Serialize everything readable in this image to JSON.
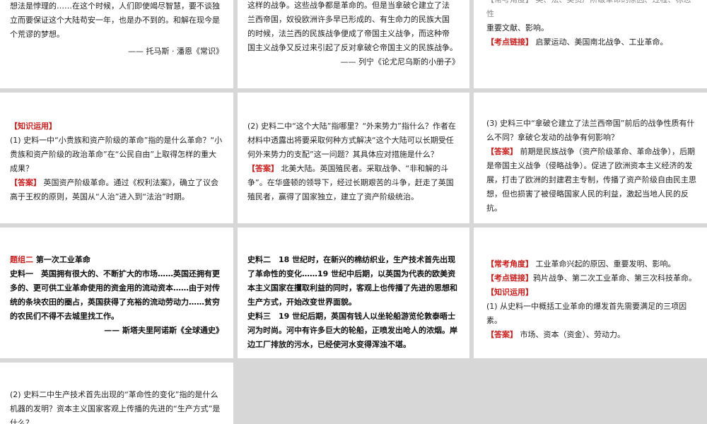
{
  "cards": {
    "c1": {
      "lines": [
        "想法是悖理的……在这个时候，人们即使竭尽智慧，要不谈独",
        "立而要保证这个大陆苟安一年，也是办不到的。和解在现今是",
        "个荒谬的梦想。"
      ],
      "source": "—— 托马斯 · 潘恩《常识》"
    },
    "c2": {
      "lines": [
        "这样的战争。这些战争都是革命的。但是当拿破仑建立了法",
        "兰西帝国，奴役欧洲许多早已形成的、有生命力的民族大国",
        "的时候，法兰西的民族战争便成了帝国主义战争，而这种帝",
        "国主义战争又反过来引起了反对拿破仑帝国主义的民族战争。"
      ],
      "source": "—— 列宁《论尤尼乌斯的小册子》"
    },
    "c3": {
      "top_line": "【常考角度】 英、法、美资产阶级革命的原因、过程、标志性",
      "line2": "重要文献、影响。",
      "kaodian_tag": "【考点链接】",
      "kaodian_text": " 启蒙运动、美国南北战争、工业革命。"
    },
    "c4": {
      "tag": "【知识运用】",
      "question": "(1) 史料一中“小贵族和资产阶级的革命”指的是什么革命？“小贵族和资产阶级的政治革命”在“公民自由”上取得怎样的重大成果？",
      "ans_tag": "【答案】",
      "answer": " 英国资产阶级革命。通过《权利法案》，确立了议会高于王权的原则，英国从“人治”进入到“法治”时期。"
    },
    "c5": {
      "question": "(2) 史料二中“这个大陆”指哪里？“外来势力”指什么？作者在材料中透露出将要采取何种方式解决“这个大陆可以长期受任何外来势力的支配”这一问题？其具体应对措施是什么？",
      "ans_tag": "【答案】",
      "answer": " 北美大陆。英国殖民者。采取战争、“非和解的斗争”。在华盛顿的领导下，经过长期艰苦的斗争，赶走了英国殖民者，赢得了国家独立，建立了资产阶级统治。"
    },
    "c6": {
      "question": "(3) 史料三中“拿破仑建立了法兰西帝国”前后的战争性质有什么不同？拿破仑发动的战争有何影响？",
      "ans_tag": "【答案】",
      "answer": " 前期是民族战争（资产阶级革命、革命战争），后期是帝国主义战争（侵略战争）。促进了欧洲资本主义经济的发展，打击了欧洲的封建君主专制，传播了资产阶级自由民主思想，但也损害了被侵略国家人民的利益，激起当地人民的反抗。"
    },
    "c7": {
      "group_tag": "题组二",
      "group_title": "  第一次工业革命",
      "sl_label": "史料一",
      "text": "　英国拥有很大的、不断扩大的市场……英国还拥有更多的、更可供工业革命使用的资金用的流动资本……由于对传统的条块农田的圈占，英国获得了充裕的流动劳动力……贫穷的农民们不得不去城里找工作。",
      "source": "—— 斯塔夫里阿诺斯《全球通史》"
    },
    "c8": {
      "sl2_label": "史料二",
      "sl2_text": "　18 世纪时，在新兴的棉纺织业，生产技术首先出现了革命性的变化……19 世纪中后期，以英国为代表的欧美资本主义国家在攫取利益的同时，客观上也传播了先进的思想和生产方式，开始改变世界面貌。",
      "sl3_label": "史料三",
      "sl3_text": "　19 世纪后期，英国有钱人以坐轮船游览伦敦泰晤士河为时尚。河中有许多巨大的轮船，正喷发出呛人的浓烟。岸边工厂排放的污水，已经使河水变得浑浊不堪。"
    },
    "c9": {
      "changkao_tag": "【常考角度】",
      "changkao_text": " 工业革命兴起的原因、重要发明、影响。",
      "kaodian_tag": "【考点链接】",
      "kaodian_text": "鸦片战争、第二次工业革命、第三次科技革命。",
      "zhishi_tag": "【知识运用】",
      "question": "(1) 从史料一中概括工业革命的爆发首先需要满足的三项因素。",
      "ans_tag": "【答案】",
      "answer": " 市场、资本（资金）、劳动力。"
    },
    "c10": {
      "question": "(2) 史料二中生产技术首先出现的“革命性的变化”指的是什么机器的发明？资本主义国家客观上传播的先进的“生产方式”是什么？"
    }
  }
}
